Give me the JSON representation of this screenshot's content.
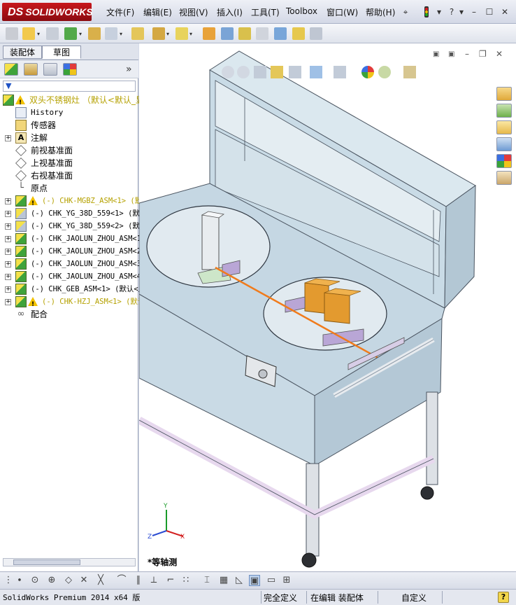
{
  "app": {
    "logo_text": "SOLIDWORKS",
    "logo_mark": "DS"
  },
  "menu": {
    "items": [
      "文件(F)",
      "编辑(E)",
      "视图(V)",
      "插入(I)",
      "工具(T)",
      "Toolbox",
      "窗口(W)",
      "帮助(H)"
    ]
  },
  "panel": {
    "tabs": [
      "装配体",
      "草图"
    ],
    "active_tab": "草图"
  },
  "tree": {
    "items": [
      {
        "label": "双头不锈钢灶 （默认<默认_显",
        "kind": "root-asm",
        "warn": true
      },
      {
        "label": "History",
        "kind": "history"
      },
      {
        "label": "传感器",
        "kind": "sensor"
      },
      {
        "label": "注解",
        "kind": "annotation"
      },
      {
        "label": "前视基准面",
        "kind": "plane"
      },
      {
        "label": "上视基准面",
        "kind": "plane"
      },
      {
        "label": "右视基准面",
        "kind": "plane"
      },
      {
        "label": "原点",
        "kind": "origin"
      },
      {
        "label": "(-) CHK-MGBZ_ASM<1> (默",
        "kind": "asm",
        "warn": true
      },
      {
        "label": "(-) CHK_YG_38D_559<1> (默认",
        "kind": "part"
      },
      {
        "label": "(-) CHK_YG_38D_559<2> (默认",
        "kind": "part"
      },
      {
        "label": "(-) CHK_JAOLUN_ZHOU_ASM<1>",
        "kind": "asm"
      },
      {
        "label": "(-) CHK_JAOLUN_ZHOU_ASM<2>",
        "kind": "asm"
      },
      {
        "label": "(-) CHK_JAOLUN_ZHOU_ASM<3>",
        "kind": "asm"
      },
      {
        "label": "(-) CHK_JAOLUN_ZHOU_ASM<4>",
        "kind": "asm"
      },
      {
        "label": "(-) CHK_GEB_ASM<1> (默认<显",
        "kind": "asm"
      },
      {
        "label": "(-) CHK-HZJ_ASM<1> (默认",
        "kind": "asm",
        "warn": true
      },
      {
        "label": "配合",
        "kind": "mates"
      }
    ]
  },
  "viewport": {
    "view_label": "*等轴测",
    "triad": {
      "x": "X",
      "y": "Y",
      "z": "Z"
    }
  },
  "status": {
    "product": "SolidWorks Premium 2014 x64 版",
    "definition": "完全定义",
    "editing": "在编辑 装配体",
    "units": "自定义",
    "help": "?"
  },
  "colors": {
    "accent_orange": "#f07b1c",
    "model_blue": "#c9dbe6",
    "logo_red": "#c8171c"
  }
}
